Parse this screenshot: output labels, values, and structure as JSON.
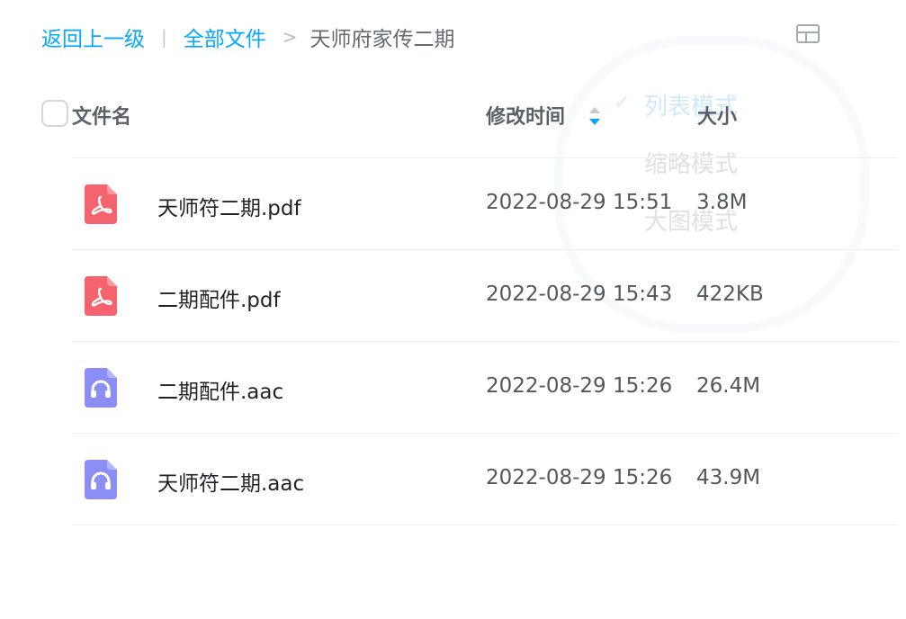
{
  "breadcrumb": {
    "back": "返回上一级",
    "separator": "|",
    "all_files": "全部文件",
    "arrow": ">",
    "current": "天师府家传二期"
  },
  "view_menu": {
    "check": "✓",
    "items": [
      "列表模式",
      "缩略模式",
      "大图模式"
    ]
  },
  "table": {
    "col_name": "文件名",
    "col_time": "修改时间",
    "col_size": "大小"
  },
  "files": [
    {
      "name": "天师符二期.pdf",
      "time": "2022-08-29 15:51",
      "size": "3.8M",
      "icon": "pdf-file-icon"
    },
    {
      "name": "二期配件.pdf",
      "time": "2022-08-29 15:43",
      "size": "422KB",
      "icon": "pdf-file-icon"
    },
    {
      "name": "二期配件.aac",
      "time": "2022-08-29 15:26",
      "size": "26.4M",
      "icon": "audio-file-icon"
    },
    {
      "name": "天师符二期.aac",
      "time": "2022-08-29 15:26",
      "size": "43.9M",
      "icon": "audio-file-icon"
    }
  ],
  "colors": {
    "link": "#06a7ff",
    "pdf_icon": "#f5646e",
    "audio_icon": "#8b8ef7"
  }
}
